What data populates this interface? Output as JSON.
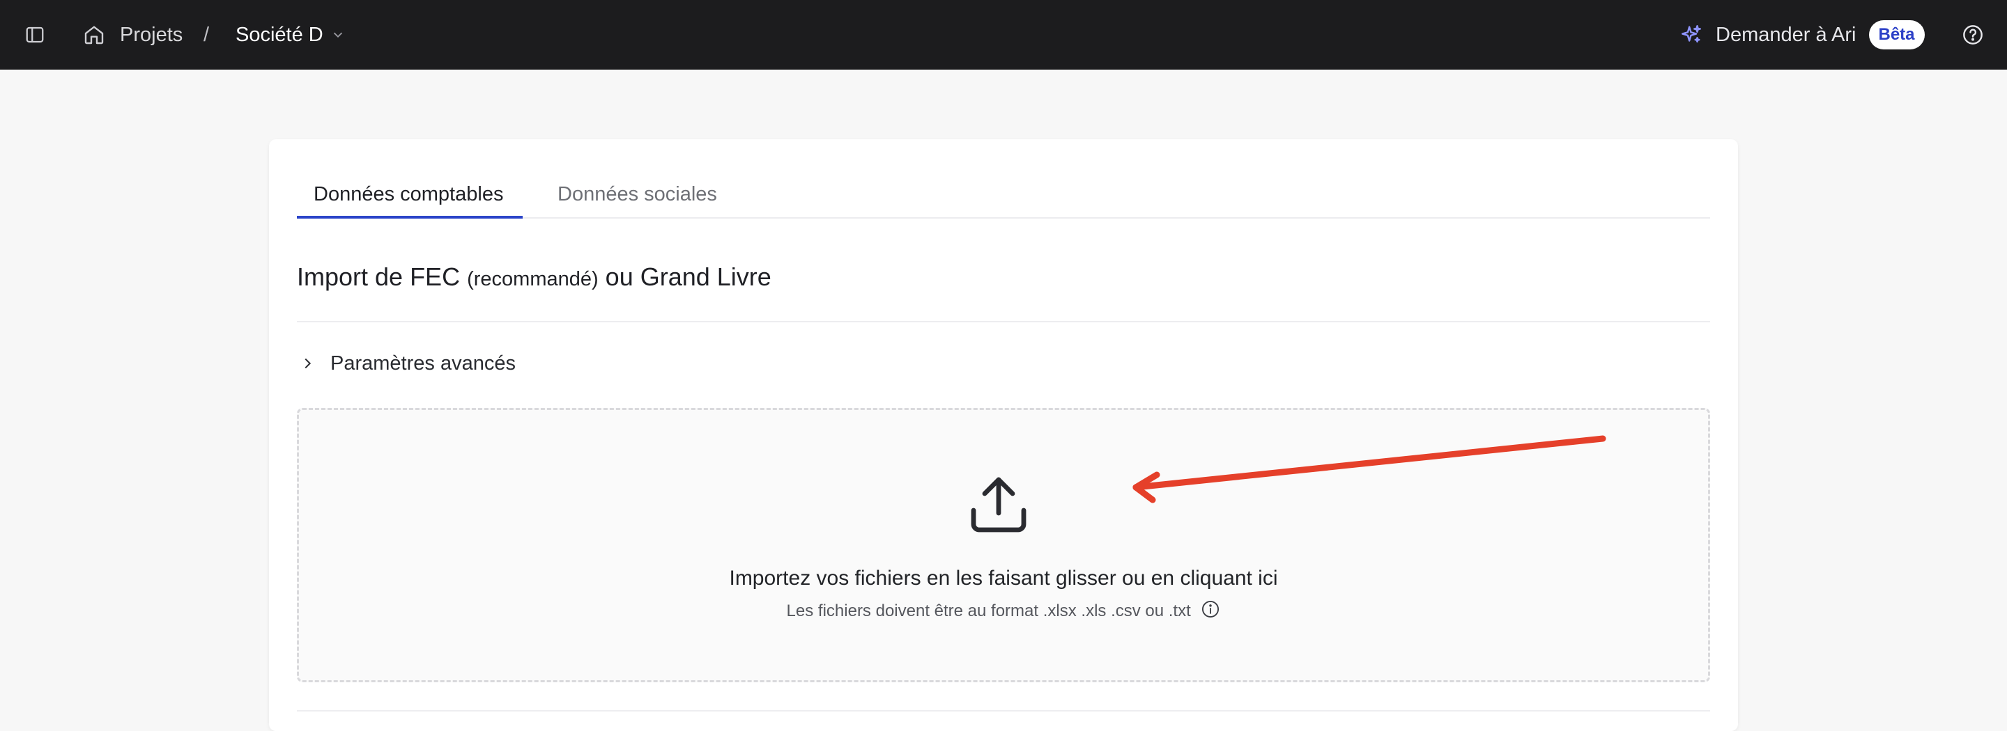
{
  "topbar": {
    "breadcrumb_projects": "Projets",
    "breadcrumb_separator": "/",
    "company_name": "Société D",
    "ask_label": "Demander à Ari",
    "beta_badge": "Bêta"
  },
  "tabs": [
    {
      "label": "Données comptables",
      "active": true
    },
    {
      "label": "Données sociales",
      "active": false
    }
  ],
  "section": {
    "title_part1": "Import de FEC",
    "title_small": "(recommandé)",
    "title_part2": "ou Grand Livre"
  },
  "advanced": {
    "label": "Paramètres avancés"
  },
  "dropzone": {
    "main_text": "Importez vos fichiers en les faisant glisser ou en cliquant ici",
    "sub_text": "Les fichiers doivent être au format .xlsx .xls .csv ou .txt"
  },
  "colors": {
    "topbar_bg": "#1c1c1e",
    "accent": "#2b44c9",
    "annotation_arrow": "#e5402a"
  },
  "icons": {
    "sidebar": "sidebar-toggle-icon",
    "home": "home-icon",
    "chevron": "chevron-down-icon",
    "sparkle": "sparkle-icon",
    "help": "help-circle-icon",
    "expand": "chevron-right-icon",
    "upload": "upload-icon",
    "info": "info-icon"
  }
}
